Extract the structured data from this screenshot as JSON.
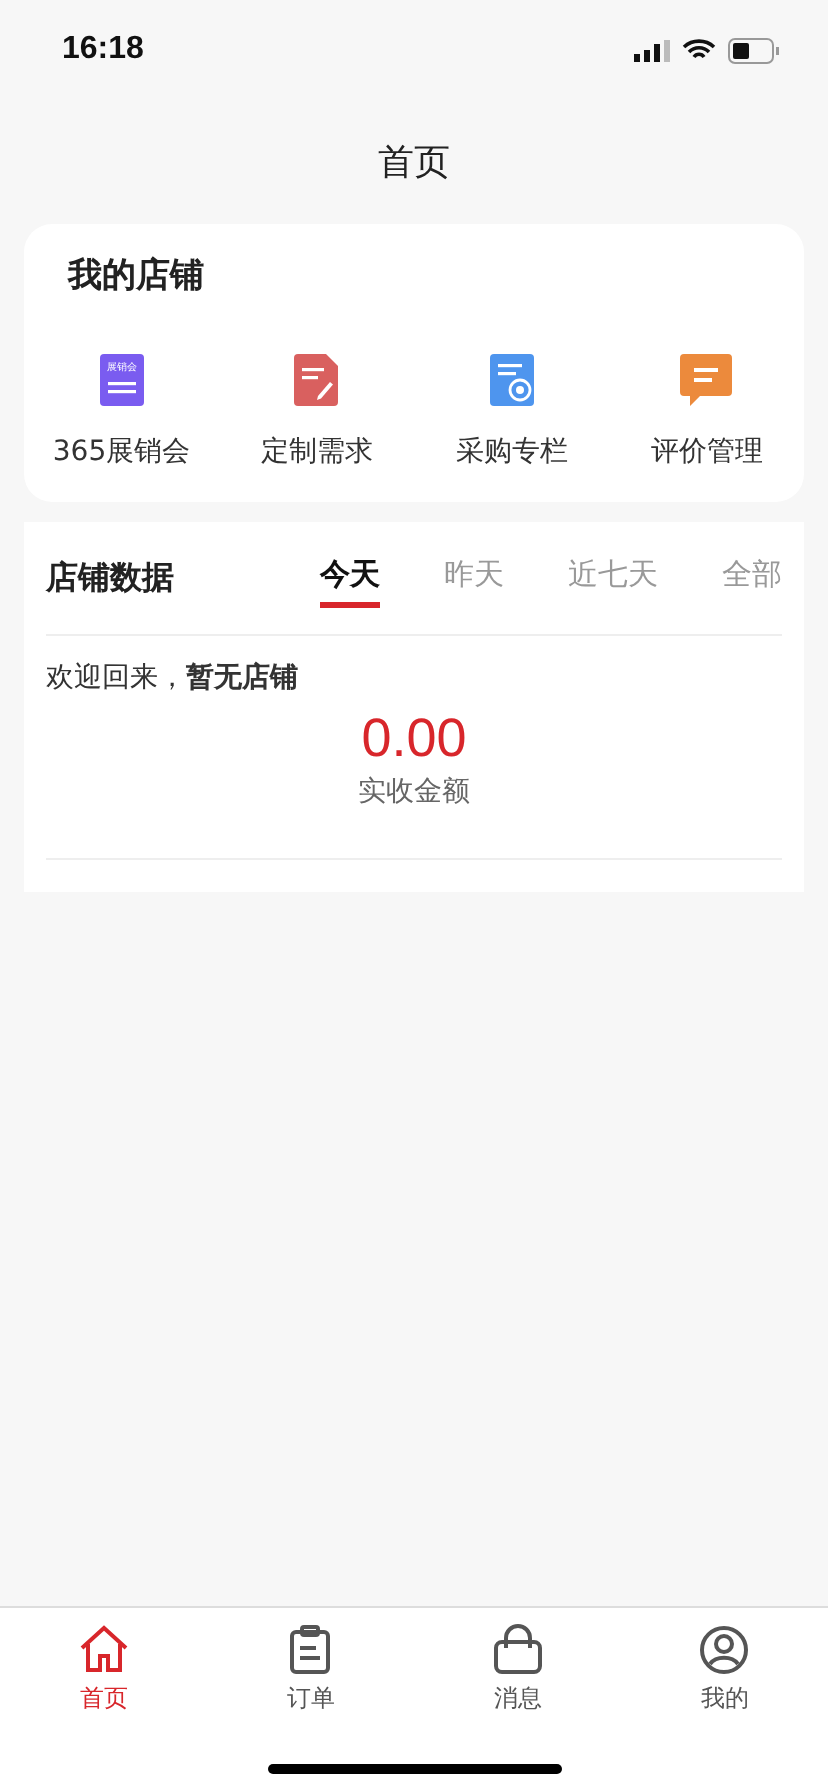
{
  "status_bar": {
    "time": "16:18"
  },
  "nav": {
    "title": "首页"
  },
  "shop": {
    "title": "我的店铺",
    "shortcuts": [
      {
        "label": "365展销会",
        "kind": "expo",
        "icon_text": "展销会"
      },
      {
        "label": "定制需求",
        "kind": "custom"
      },
      {
        "label": "采购专栏",
        "kind": "purchase"
      },
      {
        "label": "评价管理",
        "kind": "review"
      }
    ]
  },
  "stats": {
    "title": "店铺数据",
    "periods": [
      {
        "label": "今天",
        "selected": true
      },
      {
        "label": "昨天",
        "selected": false
      },
      {
        "label": "近七天",
        "selected": false
      },
      {
        "label": "全部",
        "selected": false
      }
    ],
    "welcome": "欢迎回来，**暂无店铺**",
    "amount": "0.00",
    "amount_label": "实收金额"
  },
  "tab_bar": [
    {
      "label": "首页",
      "kind": "home",
      "selected": true
    },
    {
      "label": "订单",
      "kind": "orders",
      "selected": false
    },
    {
      "label": "消息",
      "kind": "bag",
      "selected": false
    },
    {
      "label": "我的",
      "kind": "profile",
      "selected": false
    }
  ]
}
